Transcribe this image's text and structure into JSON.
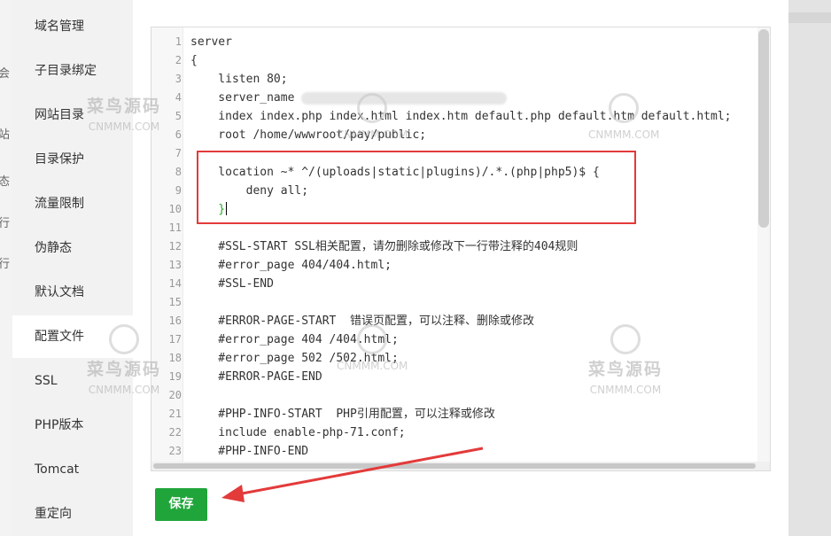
{
  "background": {
    "left_fragments": [
      "会",
      "站",
      "态",
      "行",
      "行"
    ]
  },
  "menu": {
    "items": [
      {
        "label": "域名管理",
        "active": false
      },
      {
        "label": "子目录绑定",
        "active": false
      },
      {
        "label": "网站目录",
        "active": false
      },
      {
        "label": "目录保护",
        "active": false
      },
      {
        "label": "流量限制",
        "active": false
      },
      {
        "label": "伪静态",
        "active": false
      },
      {
        "label": "默认文档",
        "active": false
      },
      {
        "label": "配置文件",
        "active": true
      },
      {
        "label": "SSL",
        "active": false
      },
      {
        "label": "PHP版本",
        "active": false
      },
      {
        "label": "Tomcat",
        "active": false
      },
      {
        "label": "重定向",
        "active": false
      }
    ]
  },
  "editor": {
    "lines": [
      "server",
      "{",
      "    listen 80;",
      "    server_name",
      "    index index.php index.html index.htm default.php default.htm default.html;",
      "    root /home/wwwroot/pay/public;",
      "",
      "    location ~* ^/(uploads|static|plugins)/.*.(php|php5)$ {",
      "        deny all;",
      "    }",
      "",
      "    #SSL-START SSL相关配置，请勿删除或修改下一行带注释的404规则",
      "    #error_page 404/404.html;",
      "    #SSL-END",
      "",
      "    #ERROR-PAGE-START  错误页配置，可以注释、删除或修改",
      "    #error_page 404 /404.html;",
      "    #error_page 502 /502.html;",
      "    #ERROR-PAGE-END",
      "",
      "    #PHP-INFO-START  PHP引用配置，可以注释或修改",
      "    include enable-php-71.conf;",
      "    #PHP-INFO-END"
    ],
    "line_numbers": [
      "1",
      "2",
      "3",
      "4",
      "5",
      "6",
      "7",
      "8",
      "9",
      "10",
      "11",
      "12",
      "13",
      "14",
      "15",
      "16",
      "17",
      "18",
      "19",
      "20",
      "21",
      "22",
      "23"
    ]
  },
  "save_button": {
    "label": "保存"
  },
  "colors": {
    "accent_green": "#20a53a",
    "highlight_red": "#e33a3a",
    "code_green": "#22aa22"
  },
  "watermark": {
    "cn": "菜鸟源码",
    "en": "CNMMM.COM"
  }
}
